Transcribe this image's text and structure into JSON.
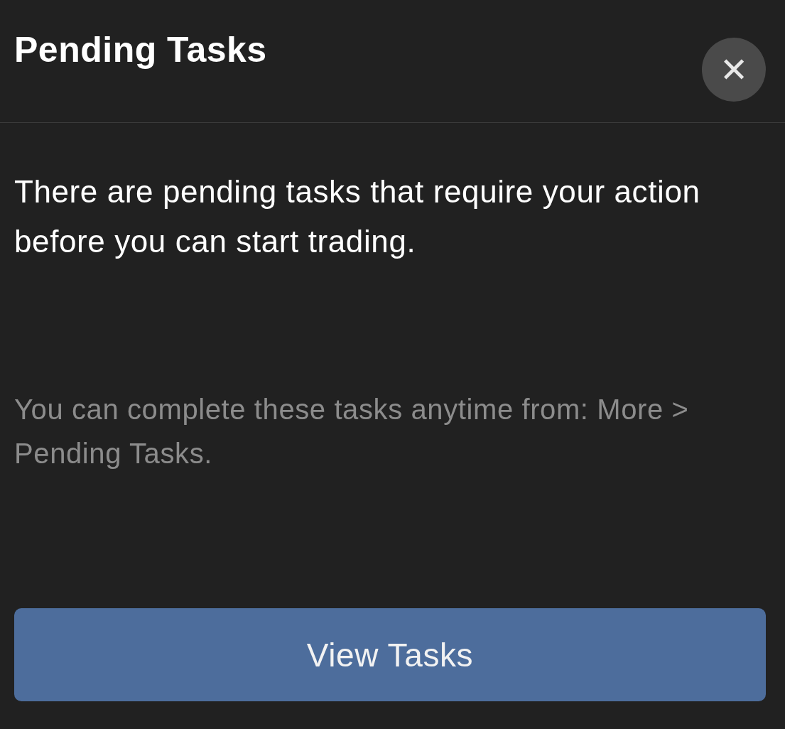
{
  "header": {
    "title": "Pending Tasks",
    "close_icon": "✕"
  },
  "message": "There are pending tasks that require your action before you can start trading.",
  "hint": "You can complete these tasks anytime from: More > Pending Tasks.",
  "button": {
    "label": "View Tasks"
  }
}
